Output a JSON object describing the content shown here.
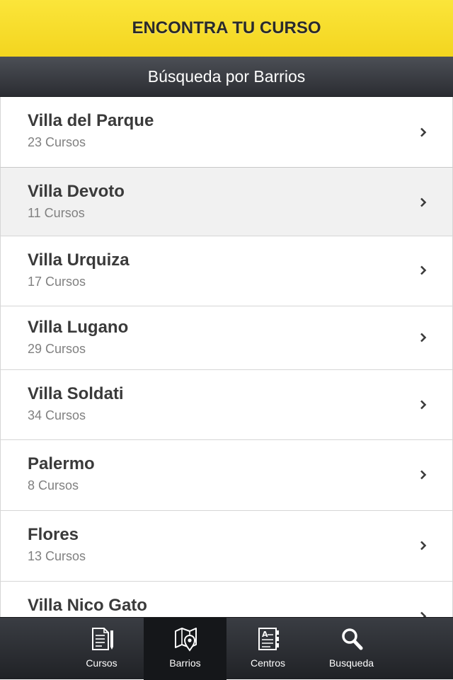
{
  "header": {
    "title": "ENCONTRA TU CURSO"
  },
  "subheader": {
    "title": "Búsqueda por Barrios"
  },
  "list": {
    "items": [
      {
        "name": "Villa del Parque",
        "count": "23 Cursos"
      },
      {
        "name": "Villa Devoto",
        "count": "11 Cursos"
      },
      {
        "name": "Villa Urquiza",
        "count": "17 Cursos"
      },
      {
        "name": "Villa Lugano",
        "count": "29 Cursos"
      },
      {
        "name": "Villa Soldati",
        "count": "34 Cursos"
      },
      {
        "name": "Palermo",
        "count": "8 Cursos"
      },
      {
        "name": "Flores",
        "count": "13 Cursos"
      },
      {
        "name": "Villa Nico Gato",
        "count": ""
      }
    ],
    "selected_index": 1
  },
  "tabbar": {
    "tabs": [
      {
        "label": "Cursos",
        "icon": "document-pencil-icon"
      },
      {
        "label": "Barrios",
        "icon": "map-pin-icon"
      },
      {
        "label": "Centros",
        "icon": "address-book-icon"
      },
      {
        "label": "Busqueda",
        "icon": "search-icon"
      }
    ],
    "active_index": 1
  },
  "colors": {
    "header_yellow": "#f8de2e",
    "subheader_dark": "#3b3e44",
    "tabbar_dark": "#2a2c30",
    "active_tab": "#15171a"
  }
}
